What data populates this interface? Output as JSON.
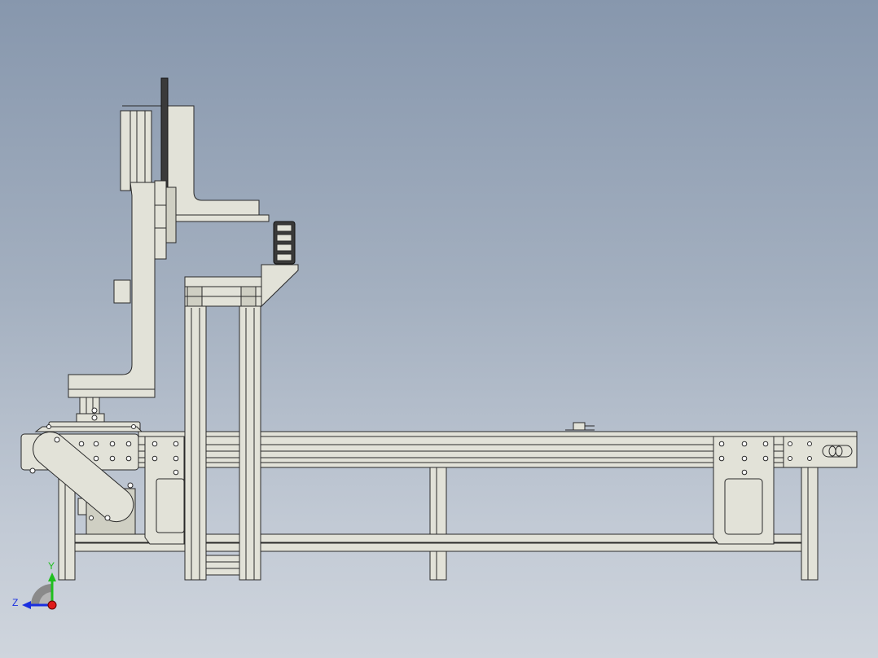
{
  "colors": {
    "background_top": "#8797ad",
    "background_bottom": "#cfd5dd",
    "part_fill": "#e2e2d8",
    "part_shade": "#cfcfc3",
    "outline": "#2a2a2a",
    "axis_y": "#1fbf1f",
    "axis_z": "#1a2fe0",
    "axis_x_dot": "#e01a1a"
  },
  "triad": {
    "y_label": "Y",
    "z_label": "Z"
  }
}
